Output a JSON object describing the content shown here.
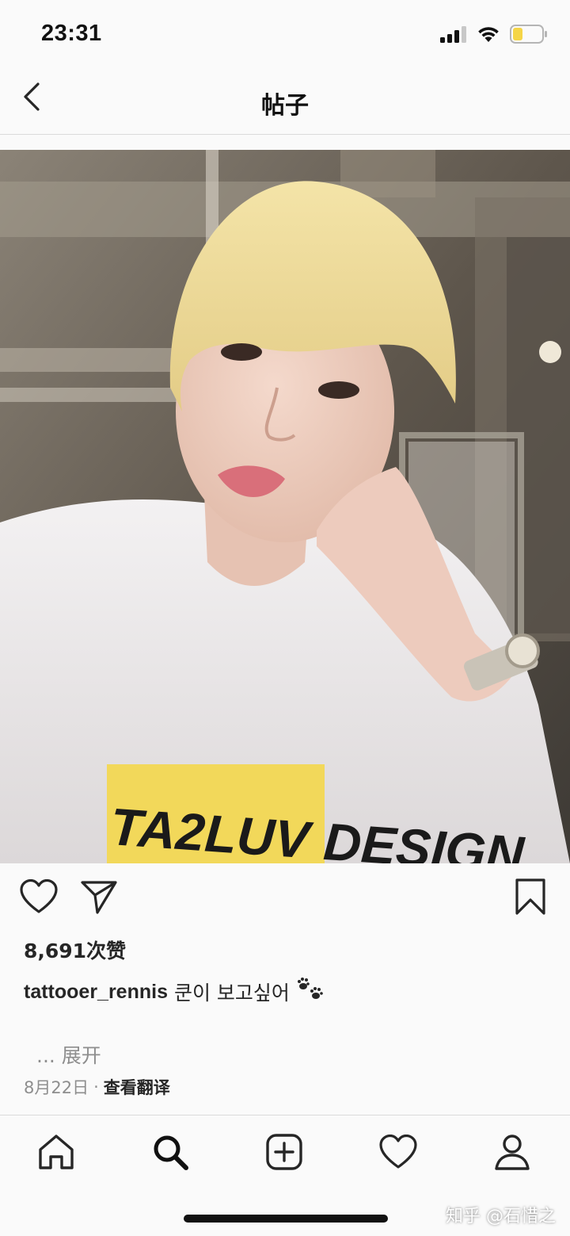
{
  "status_bar": {
    "time": "23:31",
    "signal_icon": "cellular-signal-icon",
    "wifi_icon": "wifi-icon",
    "battery_icon": "battery-low-icon",
    "battery_color": "#f5d547"
  },
  "nav": {
    "title": "帖子",
    "back_icon": "chevron-left-icon"
  },
  "post": {
    "image_description_icon": "photo",
    "shirt_print": "TA2LUV DESIGN",
    "like_icon": "heart-outline-icon",
    "share_icon": "send-paper-plane-icon",
    "save_icon": "bookmark-outline-icon",
    "likes_count": "8,691次赞",
    "username": "tattooer_rennis",
    "caption_text": "쿤이 보고싶어",
    "caption_emoji": "🐾",
    "more_label": "... 展开",
    "date": "8月22日",
    "separator": "·",
    "translate_label": "查看翻译"
  },
  "tab_bar": {
    "items": [
      {
        "name": "home",
        "icon": "home-icon"
      },
      {
        "name": "search",
        "icon": "search-icon"
      },
      {
        "name": "new-post",
        "icon": "plus-square-icon"
      },
      {
        "name": "activity",
        "icon": "heart-outline-icon"
      },
      {
        "name": "profile",
        "icon": "person-icon"
      }
    ]
  },
  "watermark": "知乎 @石惜之",
  "colors": {
    "background": "#fafafa",
    "text": "#262626",
    "secondary_text": "#8e8e8e",
    "divider": "#dbdbdb"
  }
}
